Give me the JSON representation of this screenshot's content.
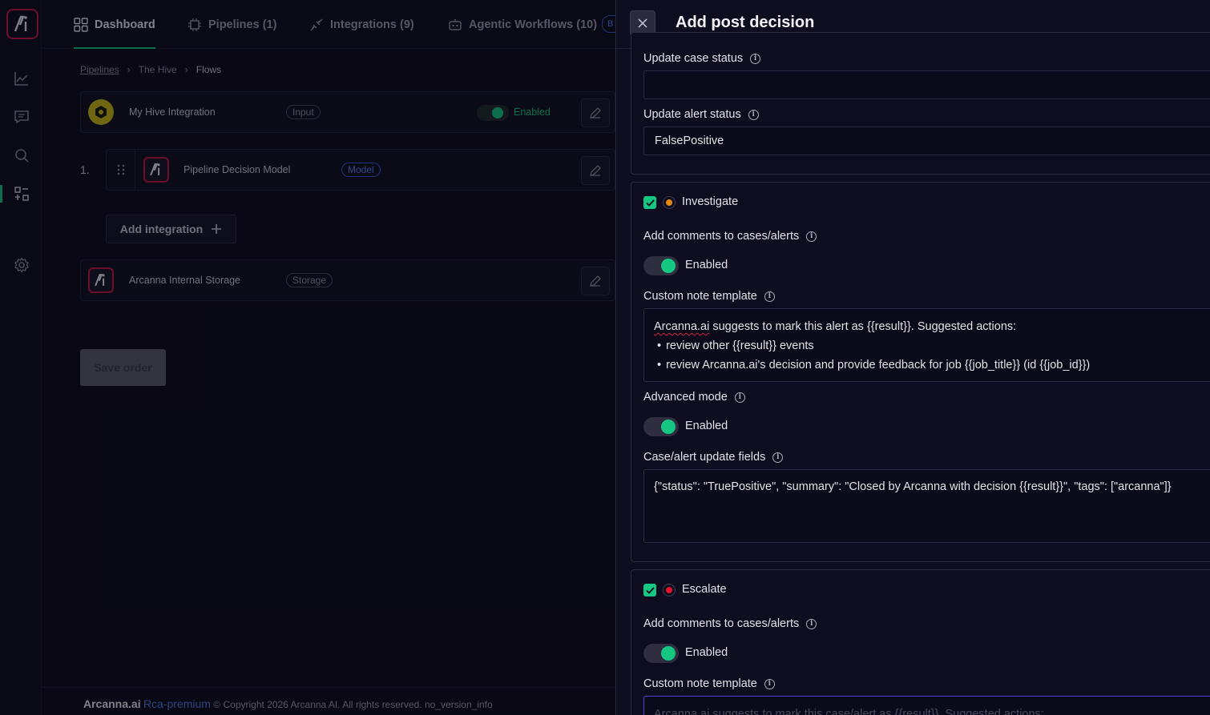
{
  "nav": {
    "tabs": [
      {
        "label": "Dashboard",
        "icon": "grid-icon",
        "active": true
      },
      {
        "label": "Pipelines (1)",
        "icon": "chip-icon"
      },
      {
        "label": "Integrations (9)",
        "icon": "plug-icon"
      },
      {
        "label": "Agentic Workflows (10)",
        "icon": "robot-icon"
      }
    ]
  },
  "breadcrumb": [
    "Pipelines",
    "The Hive",
    "Flows"
  ],
  "flow": {
    "input": {
      "name": "My Hive Integration",
      "tag": "Input",
      "status": "Enabled"
    },
    "step_number": "1.",
    "model": {
      "name": "Pipeline Decision Model",
      "tag": "Model"
    },
    "add_integration": "Add integration",
    "storage": {
      "name": "Arcanna Internal Storage",
      "tag": "Storage"
    },
    "save_order": "Save order"
  },
  "footer": {
    "brand": "Arcanna.ai",
    "edition": "Rca-premium",
    "copyright": "© Copyright 2026 Arcanna AI. All rights reserved. no_version_info"
  },
  "drawer": {
    "title": "Add post decision",
    "top_section": {
      "case_status_label": "Update case status",
      "case_status_value": "",
      "alert_status_label": "Update alert status",
      "alert_status_value": "FalsePositive"
    },
    "investigate": {
      "label": "Investigate",
      "dot_color": "#e8890c",
      "comments_label": "Add comments to cases/alerts",
      "comments_toggle": "Enabled",
      "template_label": "Custom note template",
      "template_lines": [
        "Arcanna.ai suggests to mark this alert as {{result}}. Suggested actions:",
        "review other {{result}} events",
        "review Arcanna.ai's decision and provide feedback for job {{job_title}} (id {{job_id}})"
      ],
      "advanced_label": "Advanced mode",
      "advanced_toggle": "Enabled",
      "update_fields_label": "Case/alert update fields",
      "update_fields_value": "{\"status\": \"TruePositive\", \"summary\": \"Closed by Arcanna with decision {{result}}\", \"tags\": [\"arcanna\"]}"
    },
    "escalate": {
      "label": "Escalate",
      "dot_color": "#e8102a",
      "comments_label": "Add comments to cases/alerts",
      "comments_toggle": "Enabled",
      "template_label": "Custom note template",
      "template_first_line": "Arcanna.ai suggests to mark this case/alert as {{result}}. Suggested actions:"
    }
  },
  "colors": {
    "accent": "#16c784",
    "brand": "#c2184a",
    "link": "#4b7bdc"
  }
}
